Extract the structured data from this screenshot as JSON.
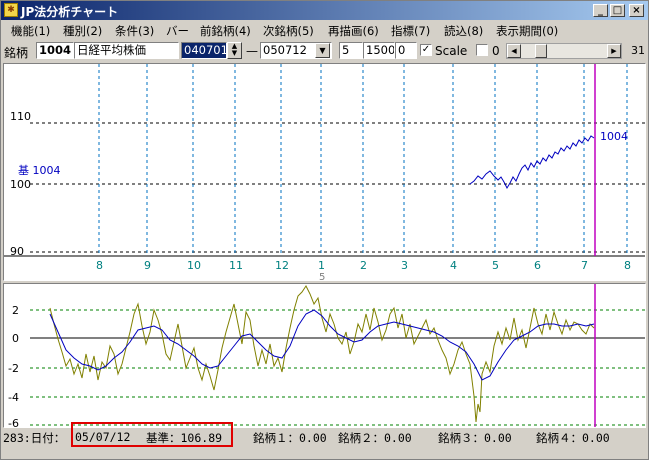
{
  "window": {
    "title": "JP法分析チャート",
    "btn_min": "_",
    "btn_max": "□",
    "btn_close": "×"
  },
  "menu": [
    "機能(1)",
    "種別(2)",
    "条件(3)",
    "バー",
    "前銘柄(4)",
    "次銘柄(5)",
    "再描画(6)",
    "指標(7)",
    "読込(8)",
    "表示期間(0)"
  ],
  "toolbar": {
    "label": "銘柄",
    "code": "1004",
    "name": "日経平均株価",
    "start_date": "040701",
    "dash": "—",
    "end_date": "050712",
    "p1": "5",
    "p2": "1500",
    "p3": "0",
    "scale_checked": "✓",
    "scale_label": "Scale",
    "zero_label": "0",
    "right_number": "31"
  },
  "upper_chart": {
    "y_ticks": [
      "110",
      "100",
      "90"
    ],
    "x_ticks": [
      "8",
      "9",
      "10",
      "11",
      "12",
      "1",
      "2",
      "3",
      "4",
      "5",
      "6",
      "7",
      "8"
    ],
    "year_label": "5",
    "base_label": "基 1004",
    "line_label": "1004",
    "colors": {
      "line": "#0000c0",
      "grid": "#000000",
      "vgrid": "#0070c0",
      "marker": "#c000c0",
      "ticks": "#008080"
    }
  },
  "lower_chart": {
    "y_ticks": [
      "2",
      "0",
      "-2",
      "-4",
      "-6"
    ],
    "colors": {
      "olive": "#808000",
      "blue": "#0000c0",
      "grid": "#008000",
      "zero": "#000000",
      "marker": "#c000c0"
    }
  },
  "status": {
    "count": "283:日付：",
    "date": "05/07/12",
    "base": "基準：106.89",
    "m1": "銘柄１：0.00",
    "m2": "銘柄２：0.00",
    "m3": "銘柄３：0.00",
    "m4": "銘柄４：0.00"
  }
}
